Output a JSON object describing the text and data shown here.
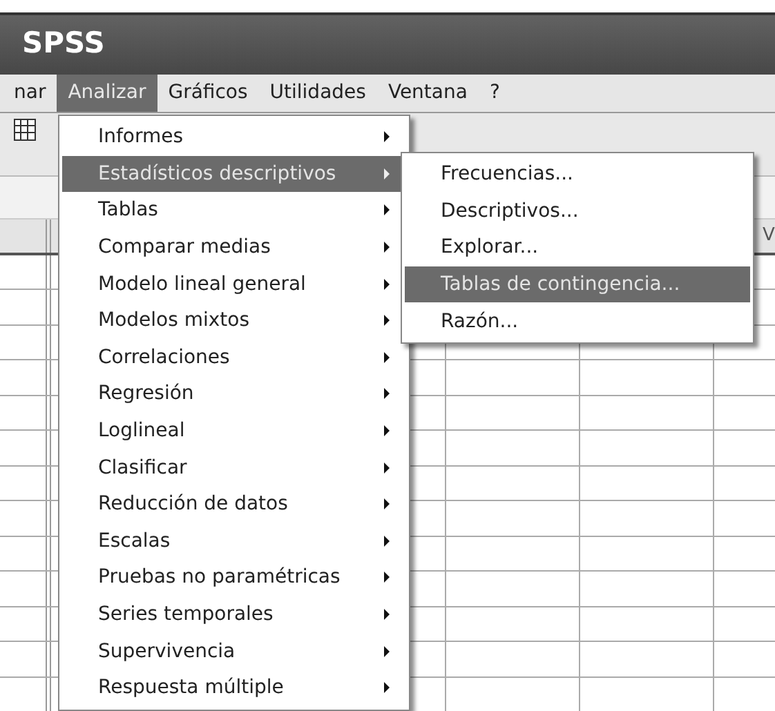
{
  "window": {
    "title": "SPSS"
  },
  "menu_bar": [
    {
      "label": "nar",
      "selected": false
    },
    {
      "label": "Analizar",
      "selected": true
    },
    {
      "label": "Gráficos",
      "selected": false
    },
    {
      "label": "Utilidades",
      "selected": false
    },
    {
      "label": "Ventana",
      "selected": false
    },
    {
      "label": "?",
      "selected": false
    }
  ],
  "menu": {
    "items": [
      {
        "label": "Informes",
        "selected": false
      },
      {
        "label": "Estadísticos descriptivos",
        "selected": true
      },
      {
        "label": "Tablas",
        "selected": false
      },
      {
        "label": "Comparar medias",
        "selected": false
      },
      {
        "label": "Modelo lineal general",
        "selected": false
      },
      {
        "label": "Modelos mixtos",
        "selected": false
      },
      {
        "label": "Correlaciones",
        "selected": false
      },
      {
        "label": "Regresión",
        "selected": false
      },
      {
        "label": "Loglineal",
        "selected": false
      },
      {
        "label": "Clasificar",
        "selected": false
      },
      {
        "label": "Reducción de datos",
        "selected": false
      },
      {
        "label": "Escalas",
        "selected": false
      },
      {
        "label": "Pruebas no paramétricas",
        "selected": false
      },
      {
        "label": "Series temporales",
        "selected": false
      },
      {
        "label": "Supervivencia",
        "selected": false
      },
      {
        "label": "Respuesta múltiple",
        "selected": false
      }
    ]
  },
  "submenu": {
    "items": [
      {
        "label": "Frecuencias...",
        "selected": false
      },
      {
        "label": "Descriptivos...",
        "selected": false
      },
      {
        "label": "Explorar...",
        "selected": false
      },
      {
        "label": "Tablas de contingencia...",
        "selected": true
      },
      {
        "label": "Razón...",
        "selected": false
      }
    ]
  },
  "data_grid": {
    "column_header": "V"
  }
}
